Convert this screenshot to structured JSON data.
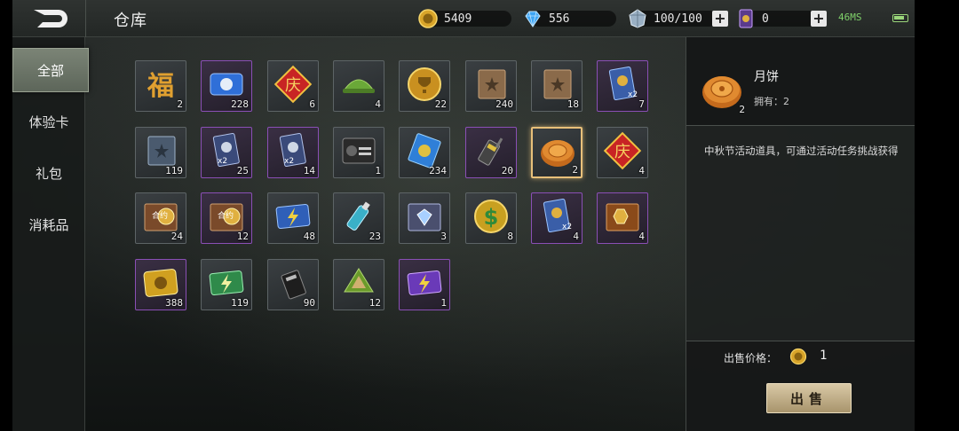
{
  "header": {
    "title": "仓库",
    "gold": "5409",
    "diamonds": "556",
    "energy": "100/100",
    "tickets": "0",
    "network": "46MS"
  },
  "sidebar": {
    "items": [
      {
        "label": "全部",
        "active": true
      },
      {
        "label": "体验卡",
        "active": false
      },
      {
        "label": "礼包",
        "active": false
      },
      {
        "label": "消耗品",
        "active": false
      }
    ]
  },
  "items": [
    {
      "name": "福-icon",
      "count": "2",
      "rarity": "normal"
    },
    {
      "name": "blue-ticket-icon",
      "count": "228",
      "rarity": "purple"
    },
    {
      "name": "庆-card-icon",
      "count": "6",
      "rarity": "normal"
    },
    {
      "name": "green-helmet-icon",
      "count": "4",
      "rarity": "normal"
    },
    {
      "name": "trophy-coin-icon",
      "count": "22",
      "rarity": "normal"
    },
    {
      "name": "brown-book-icon",
      "count": "240",
      "rarity": "normal"
    },
    {
      "name": "brown-book-icon",
      "count": "18",
      "rarity": "normal"
    },
    {
      "name": "x2-gold-card-icon",
      "count": "7",
      "rarity": "purple"
    },
    {
      "name": "blue-book-icon",
      "count": "119",
      "rarity": "normal"
    },
    {
      "name": "x2-silver-card-icon",
      "count": "25",
      "rarity": "purple"
    },
    {
      "name": "x2-silver-card-icon",
      "count": "14",
      "rarity": "purple"
    },
    {
      "name": "protect-card-icon",
      "count": "1",
      "rarity": "normal"
    },
    {
      "name": "recycle-card-icon",
      "count": "234",
      "rarity": "normal"
    },
    {
      "name": "radio-icon",
      "count": "20",
      "rarity": "purple"
    },
    {
      "name": "mooncake-icon",
      "count": "2",
      "rarity": "selected"
    },
    {
      "name": "庆-card-icon",
      "count": "4",
      "rarity": "normal"
    },
    {
      "name": "contract-coin-icon",
      "count": "24",
      "rarity": "normal"
    },
    {
      "name": "contract-coin-icon",
      "count": "12",
      "rarity": "purple"
    },
    {
      "name": "lightning-ticket-blue-icon",
      "count": "48",
      "rarity": "normal"
    },
    {
      "name": "spray-bottle-icon",
      "count": "23",
      "rarity": "normal"
    },
    {
      "name": "diamond-contract-icon",
      "count": "3",
      "rarity": "normal"
    },
    {
      "name": "dollar-coin-icon",
      "count": "8",
      "rarity": "normal"
    },
    {
      "name": "x2-gold-card-icon",
      "count": "4",
      "rarity": "purple"
    },
    {
      "name": "treasure-card-icon",
      "count": "4",
      "rarity": "purple"
    },
    {
      "name": "gold-ticket-icon",
      "count": "388",
      "rarity": "purple"
    },
    {
      "name": "lightning-ticket-green-icon",
      "count": "119",
      "rarity": "normal"
    },
    {
      "name": "radio-black-icon",
      "count": "90",
      "rarity": "normal"
    },
    {
      "name": "zongzi-icon",
      "count": "12",
      "rarity": "normal"
    },
    {
      "name": "lightning-ticket-purple-icon",
      "count": "1",
      "rarity": "purple"
    }
  ],
  "detail": {
    "name": "月饼",
    "count": "2",
    "owned": "拥有：2",
    "description": "中秋节活动道具，可通过活动任务挑战获得",
    "price_label": "出售价格：",
    "price": "1",
    "sell_label": "出售"
  }
}
